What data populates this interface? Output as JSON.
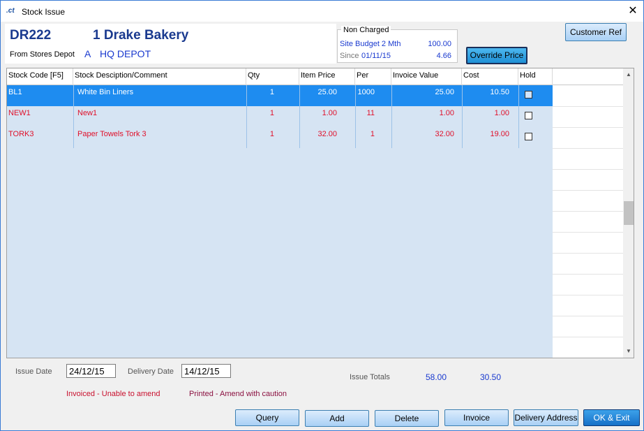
{
  "window": {
    "title": "Stock Issue",
    "icon_text": ".ct",
    "close_glyph": "✕"
  },
  "header": {
    "account_code": "DR222",
    "account_name": "1 Drake Bakery",
    "from_label": "From Stores Depot",
    "depot_code": "A",
    "depot_name": "HQ DEPOT"
  },
  "non_charged": {
    "title": "Non Charged",
    "budget_label": "Site Budget 2 Mth",
    "budget_value": "100.00",
    "since_label": "Since",
    "since_date": "01/11/15",
    "since_value": "4.66"
  },
  "buttons": {
    "override_price": "Override Price",
    "customer_ref": "Customer Ref",
    "query": "Query",
    "add": "Add",
    "delete": "Delete",
    "invoice": "Invoice",
    "delivery_address": "Delivery Address",
    "ok_exit": "OK & Exit"
  },
  "grid": {
    "columns": [
      "Stock Code [F5]",
      "Stock Desciption/Comment",
      "Qty",
      "Item Price",
      "Per",
      "Invoice Value",
      "Cost",
      "Hold"
    ],
    "rows": [
      {
        "code": "BL1",
        "description": "White Bin Liners",
        "qty": "1",
        "item_price": "25.00",
        "per": "1000",
        "invoice_value": "25.00",
        "cost": "10.50",
        "hold": false
      },
      {
        "code": "NEW1",
        "description": "New1",
        "qty": "1",
        "item_price": "1.00",
        "per": "11",
        "invoice_value": "1.00",
        "cost": "1.00",
        "hold": false
      },
      {
        "code": "TORK3",
        "description": "Paper Towels Tork 3",
        "qty": "1",
        "item_price": "32.00",
        "per": "1",
        "invoice_value": "32.00",
        "cost": "19.00",
        "hold": false
      }
    ]
  },
  "scrollbar": {
    "up_glyph": "▲",
    "down_glyph": "▼"
  },
  "footer": {
    "issue_date_label": "Issue Date",
    "issue_date": "24/12/15",
    "delivery_date_label": "Delivery Date",
    "delivery_date": "14/12/15",
    "totals_label": "Issue Totals",
    "total_invoice": "58.00",
    "total_cost": "30.50",
    "legend_invoiced": "Invoiced - Unable to amend",
    "legend_printed": "Printed - Amend with caution"
  },
  "colors": {
    "selected_row": "#1e8cf0",
    "grid_body": "#d6e4f3",
    "invoiced_text": "#e0102a",
    "header_blue": "#1a3a8f",
    "value_blue": "#1a3acf"
  }
}
